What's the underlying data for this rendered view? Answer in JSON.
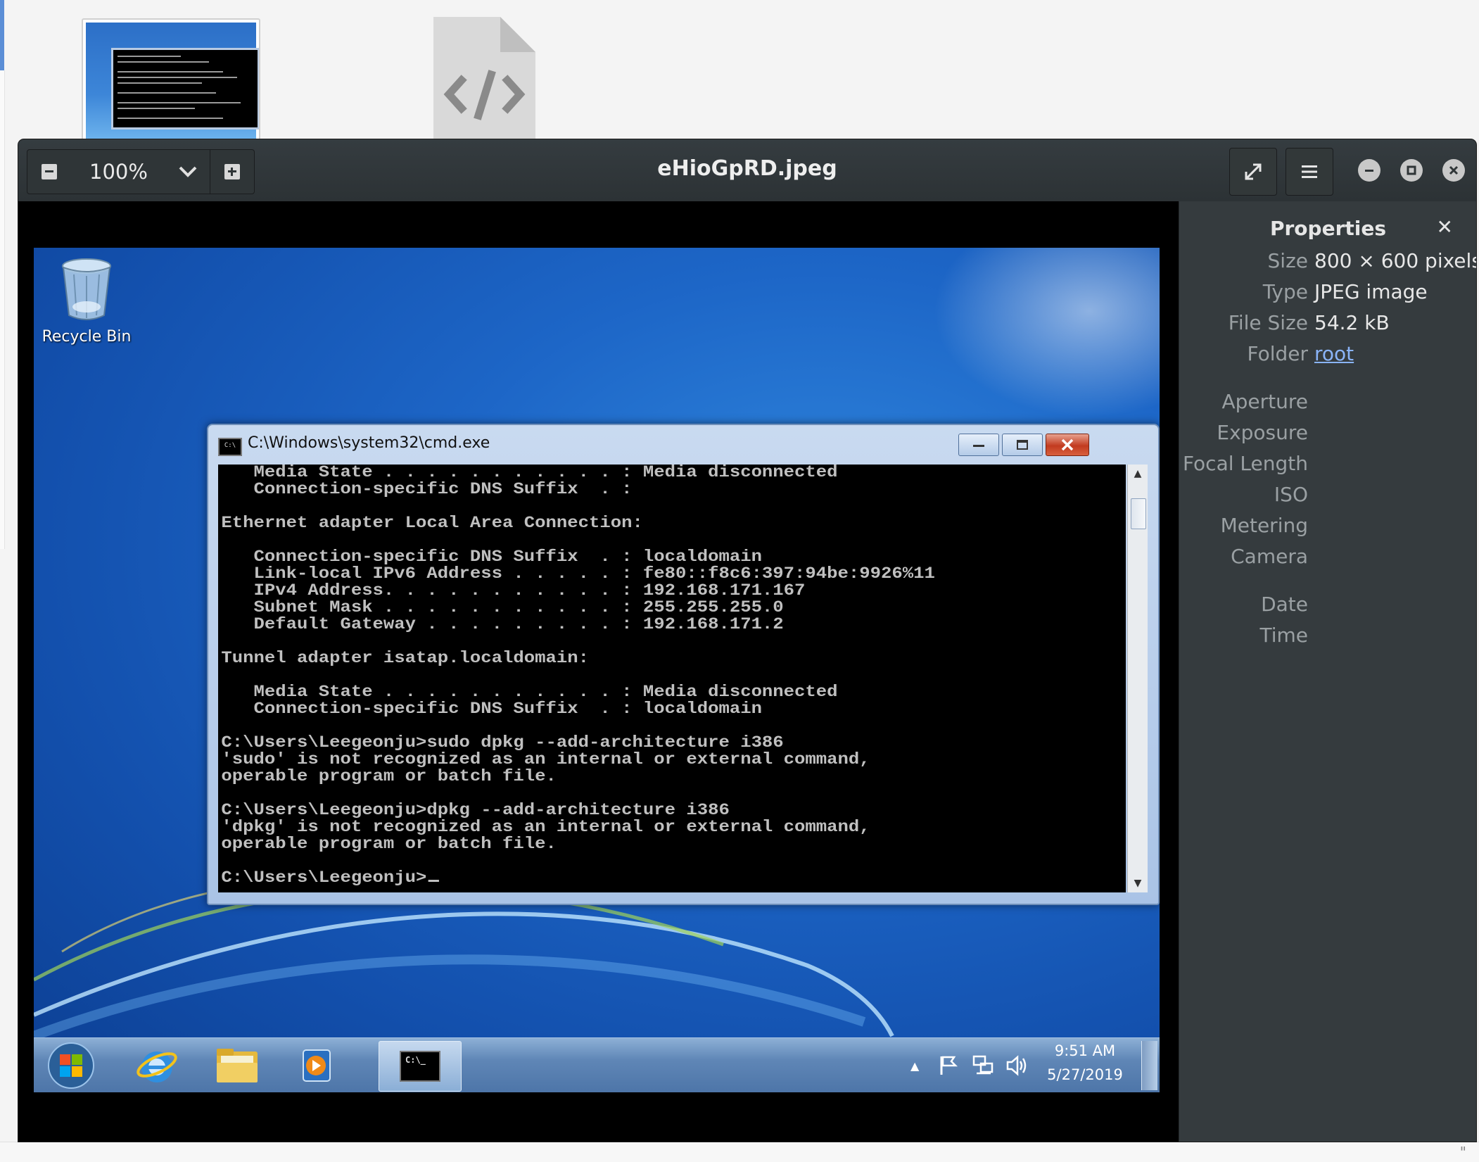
{
  "viewer": {
    "zoom_value": "100%",
    "title": "eHioGpRD.jpeg"
  },
  "properties": {
    "heading": "Properties",
    "rows": [
      {
        "label": "Size",
        "value": "800 × 600 pixels"
      },
      {
        "label": "Type",
        "value": "JPEG image"
      },
      {
        "label": "File Size",
        "value": "54.2 kB"
      },
      {
        "label": "Folder",
        "value": "root"
      }
    ],
    "exif_labels": [
      "Aperture",
      "Exposure",
      "Focal Length",
      "ISO",
      "Metering",
      "Camera"
    ],
    "date_labels": [
      "Date",
      "Time"
    ]
  },
  "image": {
    "desktop_icon_label": "Recycle Bin",
    "cmd_title": "C:\\Windows\\system32\\cmd.exe",
    "cmd_icon_text": "C:\\",
    "console_lines": [
      "   Media State . . . . . . . . . . . : Media disconnected",
      "   Connection-specific DNS Suffix  . :",
      "",
      "Ethernet adapter Local Area Connection:",
      "",
      "   Connection-specific DNS Suffix  . : localdomain",
      "   Link-local IPv6 Address . . . . . : fe80::f8c6:397:94be:9926%11",
      "   IPv4 Address. . . . . . . . . . . : 192.168.171.167",
      "   Subnet Mask . . . . . . . . . . . : 255.255.255.0",
      "   Default Gateway . . . . . . . . . : 192.168.171.2",
      "",
      "Tunnel adapter isatap.localdomain:",
      "",
      "   Media State . . . . . . . . . . . : Media disconnected",
      "   Connection-specific DNS Suffix  . : localdomain",
      "",
      "C:\\Users\\Leegeonju>sudo dpkg --add-architecture i386",
      "'sudo' is not recognized as an internal or external command,",
      "operable program or batch file.",
      "",
      "C:\\Users\\Leegeonju>dpkg --add-architecture i386",
      "'dpkg' is not recognized as an internal or external command,",
      "operable program or batch file.",
      "",
      "C:\\Users\\Leegeonju>"
    ],
    "clock_time": "9:51 AM",
    "clock_date": "5/27/2019",
    "taskbar_cmd_text": "C:\\_"
  },
  "background": {
    "corner_glyph": "\""
  }
}
